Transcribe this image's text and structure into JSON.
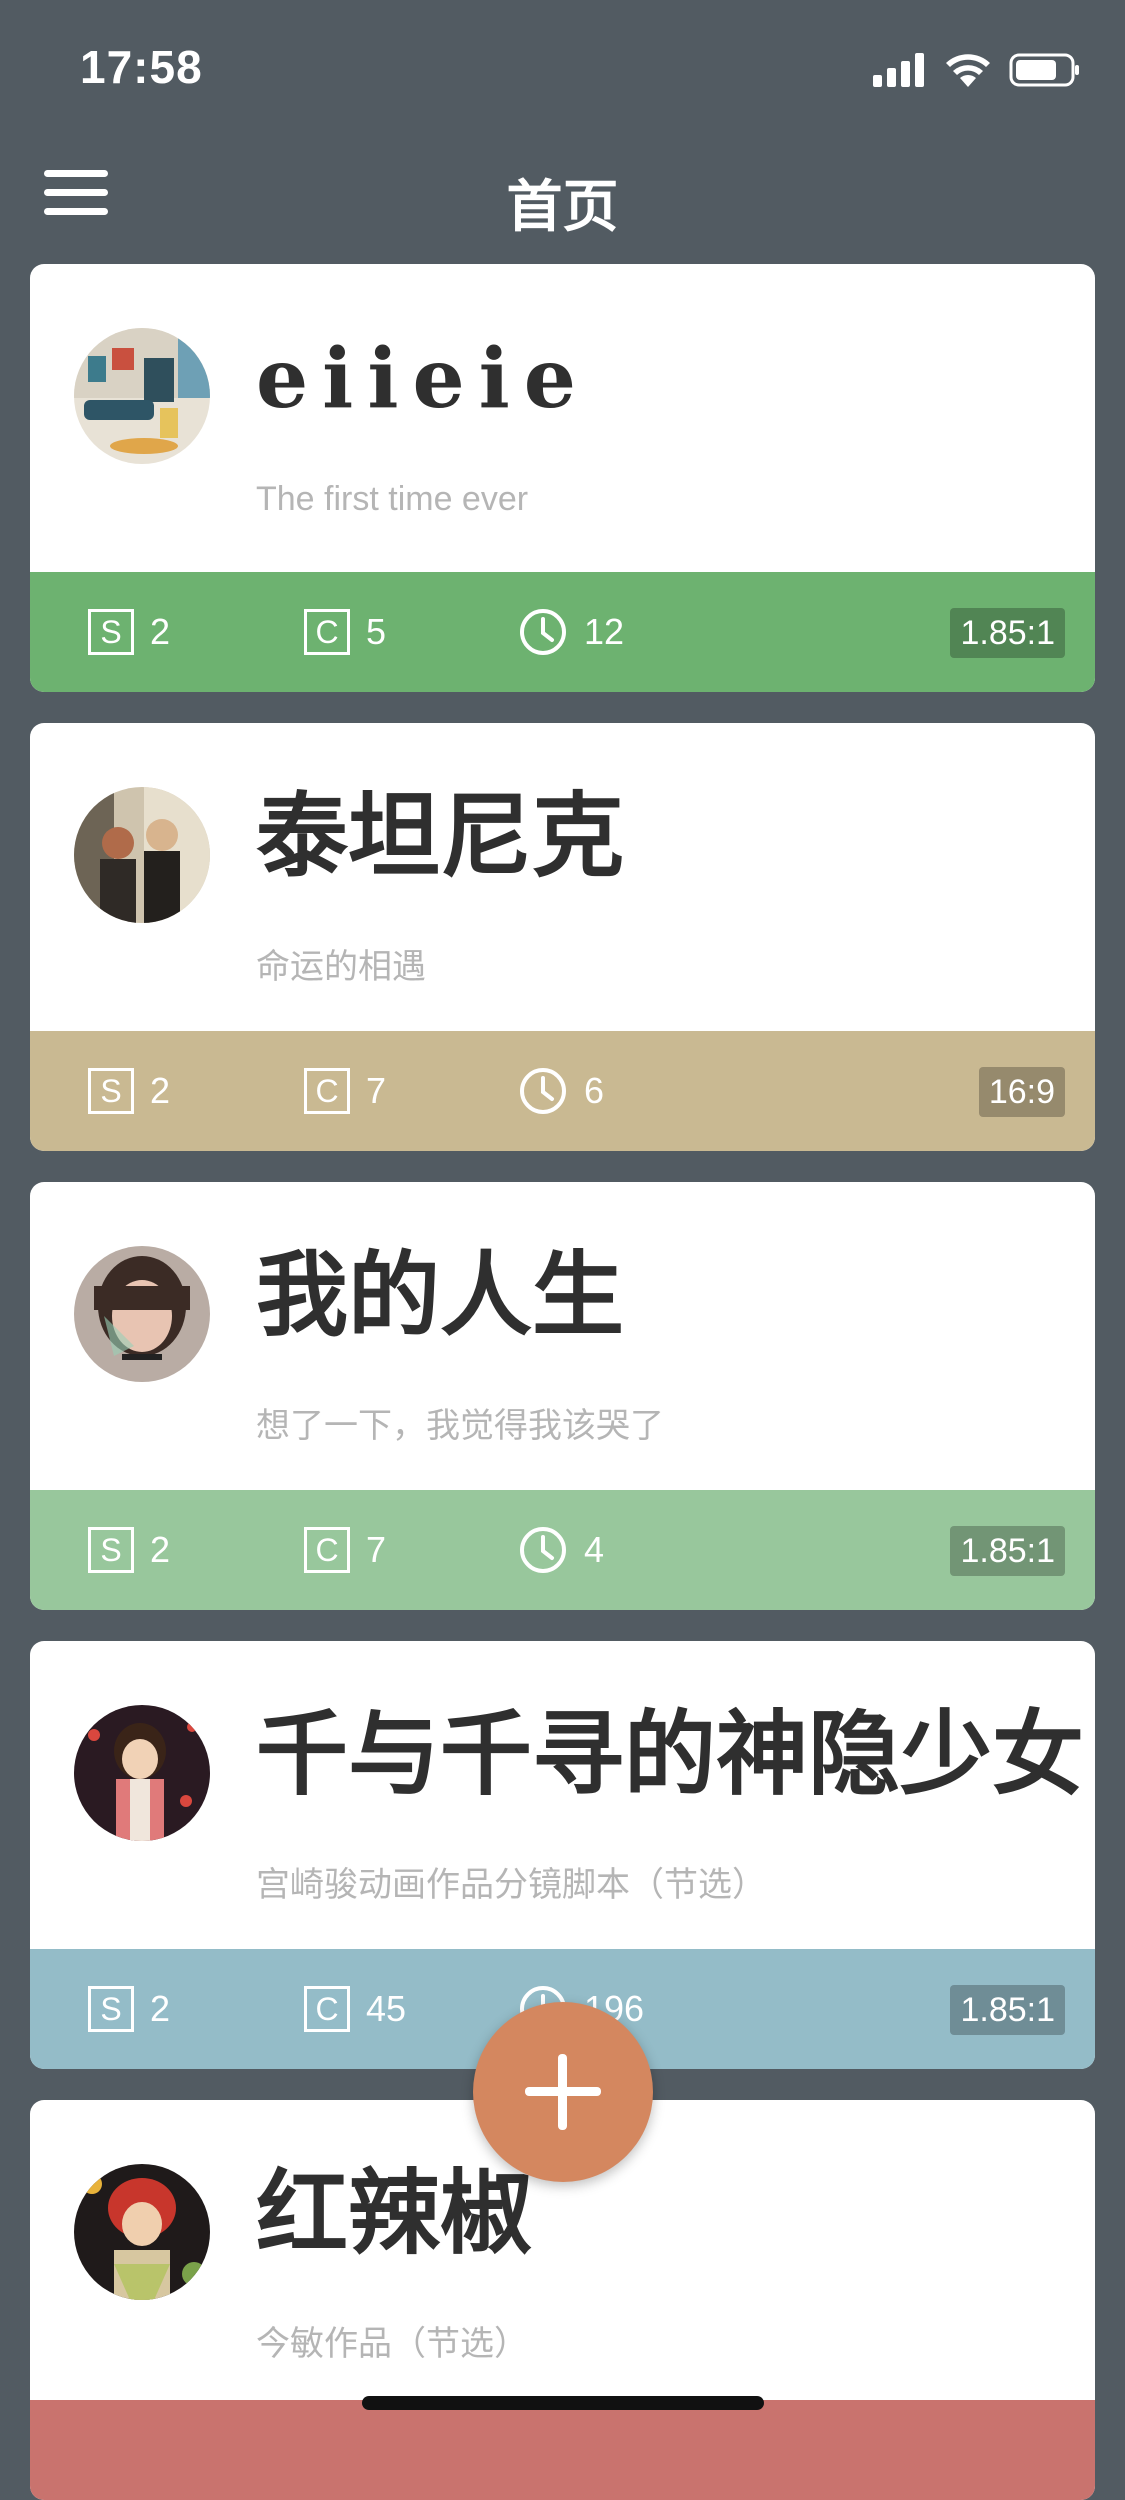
{
  "status_bar": {
    "time": "17:58"
  },
  "header": {
    "title": "首页"
  },
  "colors": {
    "background": "#525b62",
    "fab": "#d4875f"
  },
  "icons": {
    "menu": "hamburger-menu-icon",
    "scenes": "box-s-icon",
    "cuts": "box-c-icon",
    "duration": "clock-icon",
    "add": "plus-icon"
  },
  "cards": [
    {
      "title": "eiieie",
      "subtitle": "The first time ever",
      "scenes": "2",
      "cuts": "5",
      "duration": "12",
      "ratio": "1.85:1",
      "footer_color": "#6db270"
    },
    {
      "title": "泰坦尼克",
      "subtitle": "命运的相遇",
      "scenes": "2",
      "cuts": "7",
      "duration": "6",
      "ratio": "16:9",
      "footer_color": "#c9b992"
    },
    {
      "title": "我的人生",
      "subtitle": "想了一下，我觉得我该哭了",
      "scenes": "2",
      "cuts": "7",
      "duration": "4",
      "ratio": "1.85:1",
      "footer_color": "#98c79c"
    },
    {
      "title": "千与千寻的神隐少女",
      "subtitle": "宫崎骏动画作品分镜脚本（节选）",
      "scenes": "2",
      "cuts": "45",
      "duration": "196",
      "ratio": "1.85:1",
      "footer_color": "#94bcc8"
    },
    {
      "title": "红辣椒",
      "subtitle": "今敏作品（节选）",
      "footer_color": "#c9736e"
    }
  ],
  "box_labels": {
    "scenes": "S",
    "cuts": "C"
  }
}
